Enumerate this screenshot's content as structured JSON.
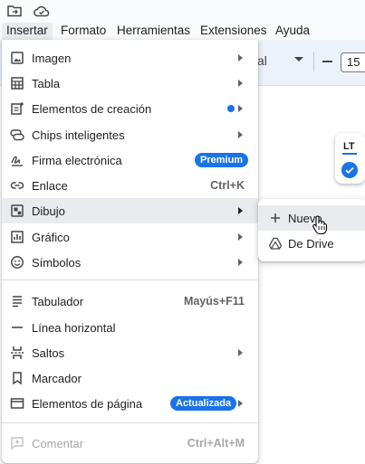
{
  "top_icons": [
    {
      "name": "folder-move-icon"
    },
    {
      "name": "cloud-saved-icon"
    }
  ],
  "menubar": {
    "items": [
      {
        "label": "Insertar",
        "active": true
      },
      {
        "label": "Formato"
      },
      {
        "label": "Herramientas"
      },
      {
        "label": "Extensiones"
      },
      {
        "label": "Ayuda"
      }
    ]
  },
  "toolbar": {
    "font_name_fragment": "al",
    "font_size": "15"
  },
  "side_widget": {
    "lt_label": "LT"
  },
  "insert_menu": {
    "items": [
      {
        "label": "Imagen",
        "icon": "image-icon",
        "submenu": true
      },
      {
        "label": "Tabla",
        "icon": "table-icon",
        "submenu": true
      },
      {
        "label": "Elementos de creación",
        "icon": "building-blocks-icon",
        "submenu": true,
        "new_dot": true
      },
      {
        "label": "Chips inteligentes",
        "icon": "smart-chips-icon",
        "submenu": true
      },
      {
        "label": "Firma electrónica",
        "icon": "esignature-icon",
        "badge": "Premium"
      },
      {
        "label": "Enlace",
        "icon": "link-icon",
        "shortcut": "Ctrl+K"
      },
      {
        "label": "Dibujo",
        "icon": "drawing-icon",
        "submenu": true,
        "hovered": true
      },
      {
        "label": "Gráfico",
        "icon": "chart-icon",
        "submenu": true
      },
      {
        "label": "Símbolos",
        "icon": "emoji-icon",
        "submenu": true
      },
      {
        "label": "Tabulador",
        "icon": "tab-icon",
        "shortcut": "Mayús+F11"
      },
      {
        "label": "Línea horizontal",
        "icon": "horizontal-line-icon"
      },
      {
        "label": "Saltos",
        "icon": "page-break-icon",
        "submenu": true
      },
      {
        "label": "Marcador",
        "icon": "bookmark-icon"
      },
      {
        "label": "Elementos de página",
        "icon": "page-elements-icon",
        "submenu": true,
        "badge": "Actualizada"
      },
      {
        "label": "Comentar",
        "icon": "add-comment-icon",
        "shortcut": "Ctrl+Alt+M",
        "disabled": true
      }
    ]
  },
  "drawing_submenu": {
    "items": [
      {
        "label": "Nuevo",
        "icon": "plus-icon",
        "hovered": true
      },
      {
        "label": "De Drive",
        "icon": "drive-icon"
      }
    ]
  },
  "colors": {
    "accent": "#1a73e8",
    "hover": "#e9ebee",
    "menubar_bg": "#f9fbfd",
    "toolbar_bg": "#edf2fa",
    "disabled_text": "#a8a8a8"
  }
}
